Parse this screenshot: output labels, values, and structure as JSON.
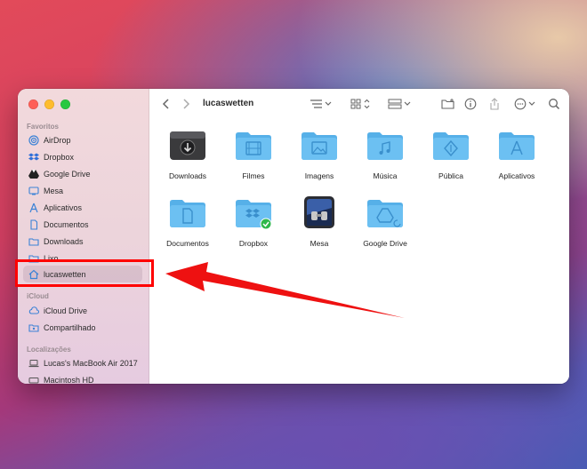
{
  "window": {
    "title": "lucaswetten"
  },
  "sidebar": {
    "sections": {
      "favorites": "Favoritos",
      "icloud": "iCloud",
      "locations": "Localizações"
    },
    "favorites": [
      {
        "label": "AirDrop",
        "icon": "airdrop-icon"
      },
      {
        "label": "Dropbox",
        "icon": "dropbox-icon"
      },
      {
        "label": "Google Drive",
        "icon": "google-drive-icon"
      },
      {
        "label": "Mesa",
        "icon": "desktop-icon"
      },
      {
        "label": "Aplicativos",
        "icon": "applications-icon"
      },
      {
        "label": "Documentos",
        "icon": "document-icon"
      },
      {
        "label": "Downloads",
        "icon": "downloads-icon"
      },
      {
        "label": "Lixo",
        "icon": "folder-icon"
      },
      {
        "label": "lucaswetten",
        "icon": "home-icon",
        "selected": true
      }
    ],
    "icloud": [
      {
        "label": "iCloud Drive",
        "icon": "cloud-icon"
      },
      {
        "label": "Compartilhado",
        "icon": "shared-folder-icon"
      }
    ],
    "locations": [
      {
        "label": "Lucas's MacBook Air 2017",
        "icon": "laptop-icon"
      },
      {
        "label": "Macintosh HD",
        "icon": "disk-icon"
      }
    ]
  },
  "files": [
    {
      "label": "Downloads",
      "icon": "downloads-drive-icon"
    },
    {
      "label": "Filmes",
      "icon": "movies-folder-icon"
    },
    {
      "label": "Imagens",
      "icon": "pictures-folder-icon"
    },
    {
      "label": "Música",
      "icon": "music-folder-icon"
    },
    {
      "label": "Pública",
      "icon": "public-folder-icon"
    },
    {
      "label": "Aplicativos",
      "icon": "applications-folder-icon"
    },
    {
      "label": "Documentos",
      "icon": "documents-folder-icon"
    },
    {
      "label": "Dropbox",
      "icon": "dropbox-folder-icon"
    },
    {
      "label": "Mesa",
      "icon": "desktop-app-icon"
    },
    {
      "label": "Google Drive",
      "icon": "google-drive-folder-icon"
    }
  ],
  "colors": {
    "folder": "#56b0e8",
    "annotation": "#ff0000"
  }
}
